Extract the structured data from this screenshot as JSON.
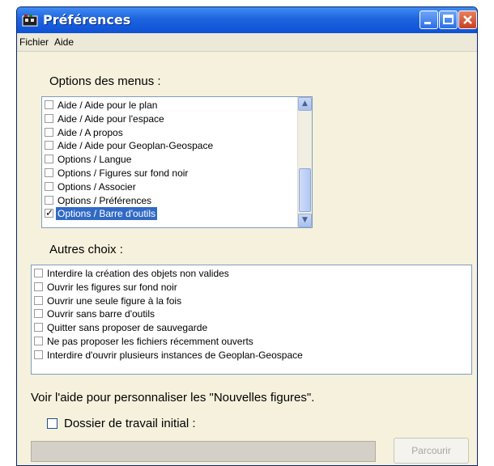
{
  "window": {
    "title": "Préférences",
    "icon": "app-icon",
    "controls": [
      "minimize",
      "maximize",
      "close"
    ]
  },
  "menubar": [
    "Fichier",
    "Aide"
  ],
  "menus_section": {
    "label": "Options des menus :",
    "items": [
      {
        "label": "Aide / Aide pour le plan",
        "checked": false
      },
      {
        "label": "Aide / Aide pour l'espace",
        "checked": false
      },
      {
        "label": "Aide / A propos",
        "checked": false
      },
      {
        "label": "Aide / Aide pour Geoplan-Geospace",
        "checked": false
      },
      {
        "label": "Options / Langue",
        "checked": false
      },
      {
        "label": "Options / Figures sur fond noir",
        "checked": false
      },
      {
        "label": "Options / Associer",
        "checked": false
      },
      {
        "label": "Options / Préférences",
        "checked": false
      },
      {
        "label": "Options / Barre d'outils",
        "checked": true,
        "selected": true
      }
    ]
  },
  "autres_section": {
    "label": "Autres choix :",
    "items": [
      {
        "label": "Interdire la création des objets non valides",
        "checked": false
      },
      {
        "label": "Ouvrir les figures sur fond noir",
        "checked": false
      },
      {
        "label": "Ouvrir une seule figure à la fois",
        "checked": false
      },
      {
        "label": "Ouvrir sans barre d'outils",
        "checked": false
      },
      {
        "label": "Quitter sans proposer de sauvegarde",
        "checked": false
      },
      {
        "label": "Ne pas proposer les fichiers récemment ouverts",
        "checked": false
      },
      {
        "label": "Interdire d'ouvrir plusieurs instances de Geoplan-Geospace",
        "checked": false
      }
    ]
  },
  "help_text": "Voir l'aide pour personnaliser les \"Nouvelles figures\".",
  "working_folder": {
    "label": "Dossier de travail initial :",
    "checked": false,
    "value": ""
  },
  "browse_label": "Parcourir",
  "colors": {
    "title_bar": "#1e63de",
    "dialog_bg": "#f6f1dd",
    "selection": "#316ac5"
  }
}
